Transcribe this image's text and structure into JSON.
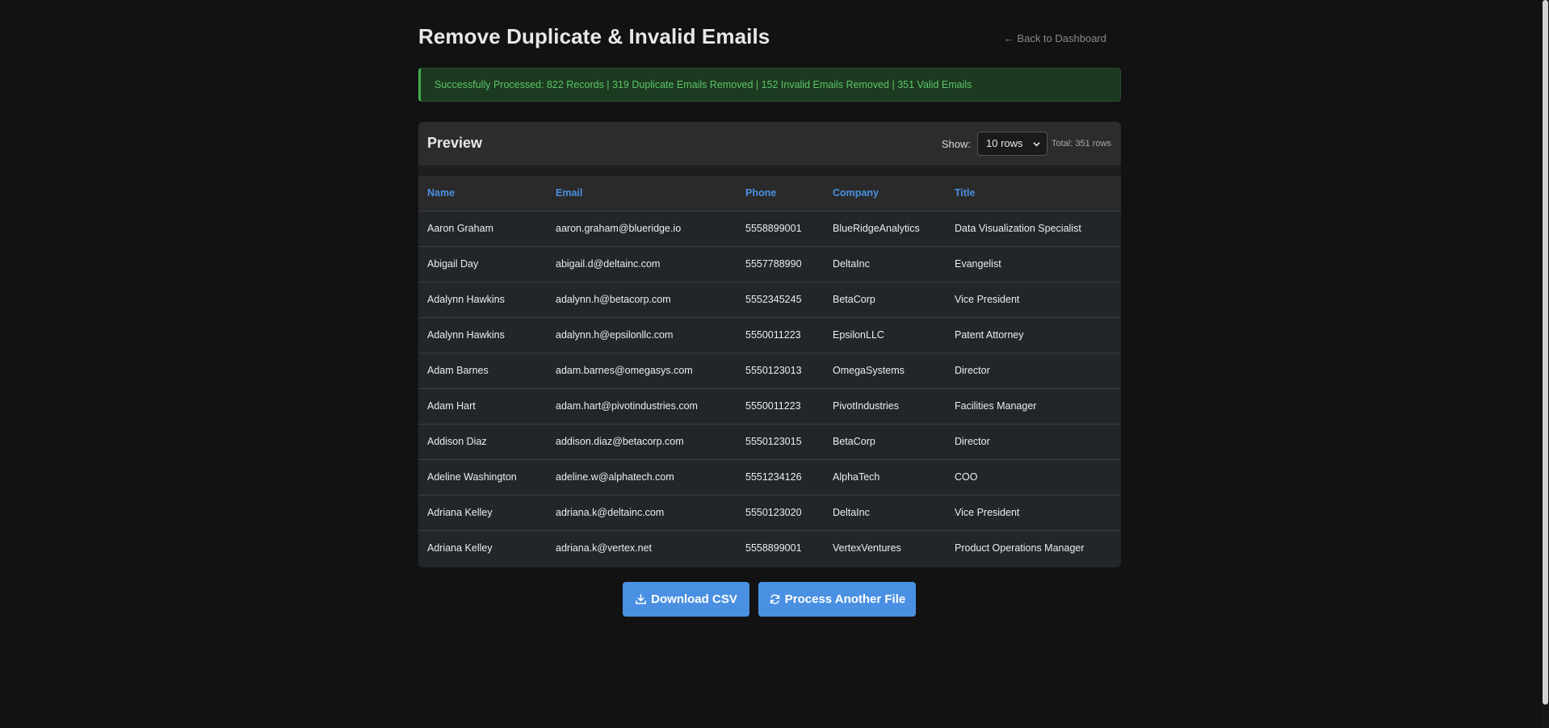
{
  "header": {
    "title": "Remove Duplicate & Invalid Emails",
    "back_link": "← Back to Dashboard"
  },
  "alert": {
    "message": "Successfully Processed: 822 Records | 319 Duplicate Emails Removed | 152 Invalid Emails Removed | 351 Valid Emails",
    "color": "#5cc46a"
  },
  "preview": {
    "title": "Preview",
    "show_label": "Show:",
    "rows_selected": "10 rows",
    "total": "Total: 351 rows"
  },
  "table": {
    "columns": [
      "Name",
      "Email",
      "Phone",
      "Company",
      "Title"
    ],
    "rows": [
      [
        "Aaron Graham",
        "aaron.graham@blueridge.io",
        "5558899001",
        "BlueRidgeAnalytics",
        "Data Visualization Specialist"
      ],
      [
        "Abigail Day",
        "abigail.d@deltainc.com",
        "5557788990",
        "DeltaInc",
        "Evangelist"
      ],
      [
        "Adalynn Hawkins",
        "adalynn.h@betacorp.com",
        "5552345245",
        "BetaCorp",
        "Vice President"
      ],
      [
        "Adalynn Hawkins",
        "adalynn.h@epsilonllc.com",
        "5550011223",
        "EpsilonLLC",
        "Patent Attorney"
      ],
      [
        "Adam Barnes",
        "adam.barnes@omegasys.com",
        "5550123013",
        "OmegaSystems",
        "Director"
      ],
      [
        "Adam Hart",
        "adam.hart@pivotindustries.com",
        "5550011223",
        "PivotIndustries",
        "Facilities Manager"
      ],
      [
        "Addison Diaz",
        "addison.diaz@betacorp.com",
        "5550123015",
        "BetaCorp",
        "Director"
      ],
      [
        "Adeline Washington",
        "adeline.w@alphatech.com",
        "5551234126",
        "AlphaTech",
        "COO"
      ],
      [
        "Adriana Kelley",
        "adriana.k@deltainc.com",
        "5550123020",
        "DeltaInc",
        "Vice President"
      ],
      [
        "Adriana Kelley",
        "adriana.k@vertex.net",
        "5558899001",
        "VertexVentures",
        "Product Operations Manager"
      ]
    ]
  },
  "actions": {
    "download_label": "Download CSV",
    "download_icon": "download-icon",
    "process_label": "Process Another File",
    "process_icon": "refresh-icon"
  },
  "colors": {
    "accent": "#4a90e2",
    "background": "#121212",
    "success": "#5cc46a"
  }
}
